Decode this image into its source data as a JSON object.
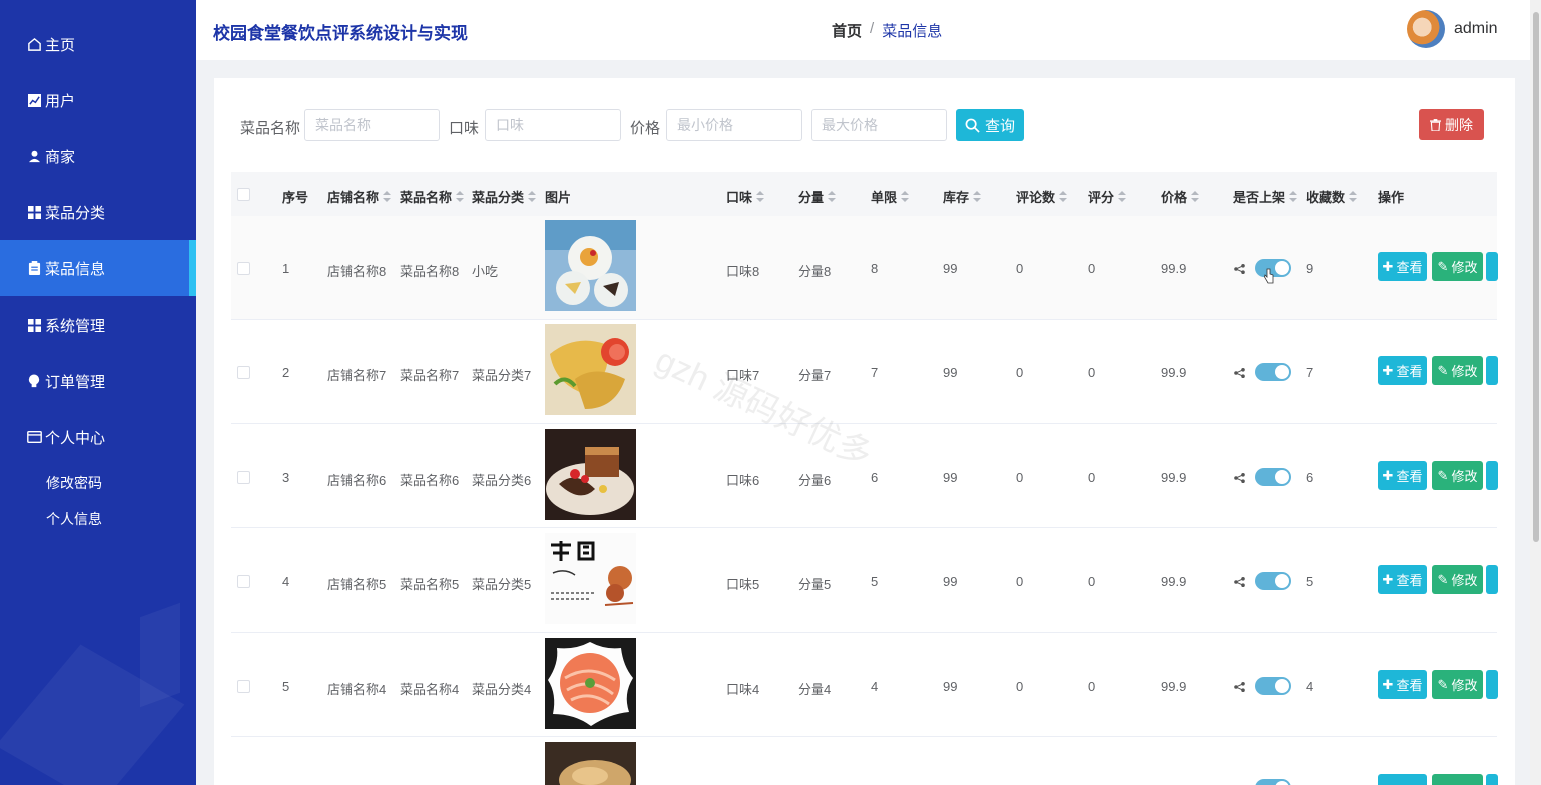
{
  "app_title": "校园食堂餐饮点评系统设计与实现",
  "breadcrumb": {
    "home": "首页",
    "separator": "/",
    "current": "菜品信息"
  },
  "user": {
    "name": "admin"
  },
  "sidebar": {
    "items": [
      {
        "label": "主页",
        "icon": "home-icon"
      },
      {
        "label": "用户",
        "icon": "chart-icon"
      },
      {
        "label": "商家",
        "icon": "person-icon"
      },
      {
        "label": "菜品分类",
        "icon": "grid-icon"
      },
      {
        "label": "菜品信息",
        "icon": "clipboard-icon",
        "active": true
      },
      {
        "label": "系统管理",
        "icon": "grid-icon"
      },
      {
        "label": "订单管理",
        "icon": "bulb-icon"
      },
      {
        "label": "个人中心",
        "icon": "card-icon"
      }
    ],
    "sub_items": [
      "修改密码",
      "个人信息"
    ]
  },
  "search": {
    "name_label": "菜品名称",
    "name_placeholder": "菜品名称",
    "taste_label": "口味",
    "taste_placeholder": "口味",
    "price_label": "价格",
    "min_price_placeholder": "最小价格",
    "max_price_placeholder": "最大价格",
    "search_button": "查询",
    "delete_button": "删除"
  },
  "table": {
    "headers": {
      "index": "序号",
      "shop": "店铺名称",
      "dish": "菜品名称",
      "category": "菜品分类",
      "image": "图片",
      "taste": "口味",
      "portion": "分量",
      "limit": "单限",
      "stock": "库存",
      "comments": "评论数",
      "rating": "评分",
      "price": "价格",
      "on_shelf": "是否上架",
      "favorites": "收藏数",
      "actions": "操作"
    },
    "rows": [
      {
        "index": "1",
        "shop": "店铺名称8",
        "dish": "菜品名称8",
        "category": "小吃",
        "taste": "口味8",
        "portion": "分量8",
        "limit": "8",
        "stock": "99",
        "comments": "0",
        "rating": "0",
        "price": "99.9",
        "on_shelf": true,
        "favorites": "9"
      },
      {
        "index": "2",
        "shop": "店铺名称7",
        "dish": "菜品名称7",
        "category": "菜品分类7",
        "taste": "口味7",
        "portion": "分量7",
        "limit": "7",
        "stock": "99",
        "comments": "0",
        "rating": "0",
        "price": "99.9",
        "on_shelf": true,
        "favorites": "7"
      },
      {
        "index": "3",
        "shop": "店铺名称6",
        "dish": "菜品名称6",
        "category": "菜品分类6",
        "taste": "口味6",
        "portion": "分量6",
        "limit": "6",
        "stock": "99",
        "comments": "0",
        "rating": "0",
        "price": "99.9",
        "on_shelf": true,
        "favorites": "6"
      },
      {
        "index": "4",
        "shop": "店铺名称5",
        "dish": "菜品名称5",
        "category": "菜品分类5",
        "taste": "口味5",
        "portion": "分量5",
        "limit": "5",
        "stock": "99",
        "comments": "0",
        "rating": "0",
        "price": "99.9",
        "on_shelf": true,
        "favorites": "5"
      },
      {
        "index": "5",
        "shop": "店铺名称4",
        "dish": "菜品名称4",
        "category": "菜品分类4",
        "taste": "口味4",
        "portion": "分量4",
        "limit": "4",
        "stock": "99",
        "comments": "0",
        "rating": "0",
        "price": "99.9",
        "on_shelf": true,
        "favorites": "4"
      }
    ],
    "view_label": "查看",
    "edit_label": "修改"
  },
  "watermark": "gzh 源码好优多",
  "colors": {
    "sidebar": "#1d35a8",
    "active_item": "#2a6de0",
    "primary_button": "#1eb7d8",
    "edit_button": "#2ab27b",
    "delete_button": "#d9534f"
  }
}
